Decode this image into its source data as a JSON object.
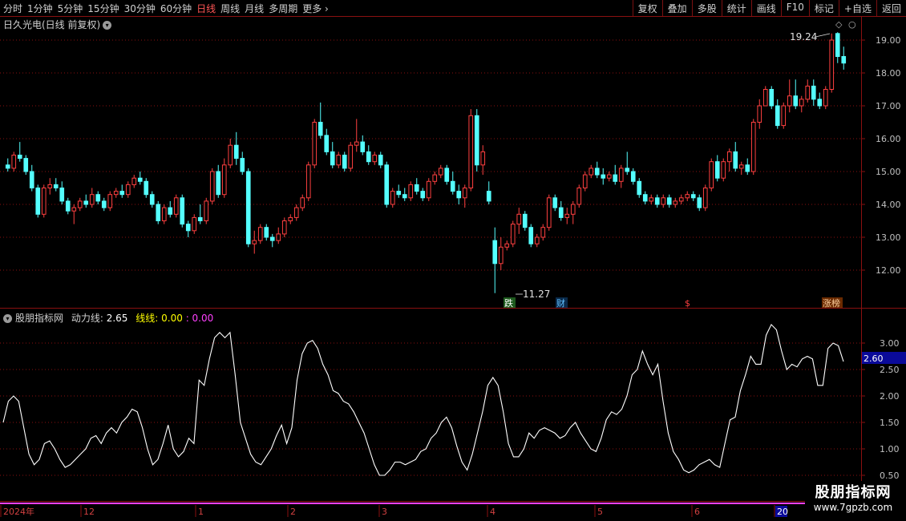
{
  "toolbar": {
    "periods": [
      "分时",
      "1分钟",
      "5分钟",
      "15分钟",
      "30分钟",
      "60分钟",
      "日线",
      "周线",
      "月线",
      "多周期",
      "更多"
    ],
    "active_period": "日线",
    "actions": [
      "复权",
      "叠加",
      "多股",
      "统计",
      "画线",
      "F10",
      "标记",
      "+自选",
      "返回"
    ]
  },
  "main_title": "日久光电(日线 前复权)",
  "price_axis": [
    "19.00",
    "18.00",
    "17.00",
    "16.00",
    "15.00",
    "14.00",
    "13.00",
    "12.00"
  ],
  "annotations": {
    "high_label": "19.24",
    "low_label": "11.27",
    "markers": [
      "跌",
      "财",
      "$",
      "涨榜"
    ]
  },
  "indicator": {
    "name": "股朋指标网",
    "line1_label": "动力线:",
    "line1_value": "2.65",
    "line2_label": "线线:",
    "line2_value": "0.00",
    "line3_value": ": 0.00",
    "axis": [
      "3.00",
      "2.50",
      "2.00",
      "1.50",
      "1.00",
      "0.50"
    ],
    "current_value": "2.60"
  },
  "date_axis": [
    "2024年",
    "12",
    "1",
    "2",
    "3",
    "4",
    "5",
    "6",
    "20"
  ],
  "watermark": {
    "line1": "股朋指标网",
    "line2": "www.7gpzb.com"
  },
  "colors": {
    "up": "#ff4040",
    "down": "#54ffff",
    "grid": "#8a1010",
    "active": "#ff5555"
  },
  "chart_data": [
    {
      "type": "candlestick",
      "title": "日久光电(日线 前复权)",
      "ylim": [
        11.0,
        19.6
      ],
      "annotations": [
        {
          "label": "19.24",
          "kind": "high"
        },
        {
          "label": "11.27",
          "kind": "low"
        }
      ],
      "ohlc": [
        [
          15.2,
          15.4,
          15.0,
          15.1
        ],
        [
          15.1,
          15.6,
          15.0,
          15.5
        ],
        [
          15.5,
          15.9,
          15.3,
          15.4
        ],
        [
          15.4,
          15.5,
          14.9,
          15.0
        ],
        [
          15.0,
          15.2,
          14.4,
          14.5
        ],
        [
          14.5,
          14.6,
          13.6,
          13.7
        ],
        [
          13.7,
          14.6,
          13.6,
          14.5
        ],
        [
          14.5,
          14.8,
          14.3,
          14.6
        ],
        [
          14.6,
          14.8,
          14.4,
          14.5
        ],
        [
          14.5,
          14.7,
          14.0,
          14.1
        ],
        [
          14.1,
          14.2,
          13.7,
          13.8
        ],
        [
          13.8,
          14.0,
          13.4,
          13.9
        ],
        [
          13.9,
          14.2,
          13.8,
          14.1
        ],
        [
          14.1,
          14.3,
          13.9,
          14.0
        ],
        [
          14.0,
          14.5,
          13.9,
          14.3
        ],
        [
          14.3,
          14.4,
          14.0,
          14.1
        ],
        [
          14.1,
          14.2,
          13.8,
          13.9
        ],
        [
          13.9,
          14.4,
          13.8,
          14.3
        ],
        [
          14.3,
          14.5,
          14.2,
          14.4
        ],
        [
          14.4,
          14.6,
          14.2,
          14.3
        ],
        [
          14.3,
          14.7,
          14.2,
          14.6
        ],
        [
          14.6,
          14.9,
          14.5,
          14.8
        ],
        [
          14.8,
          15.0,
          14.6,
          14.7
        ],
        [
          14.7,
          14.8,
          14.2,
          14.3
        ],
        [
          14.3,
          14.4,
          13.9,
          14.0
        ],
        [
          14.0,
          14.1,
          13.4,
          13.5
        ],
        [
          13.5,
          14.0,
          13.4,
          13.9
        ],
        [
          13.9,
          14.1,
          13.6,
          13.7
        ],
        [
          13.7,
          14.3,
          13.6,
          14.2
        ],
        [
          14.2,
          14.3,
          13.3,
          13.4
        ],
        [
          13.4,
          13.5,
          13.0,
          13.2
        ],
        [
          13.2,
          13.7,
          13.1,
          13.6
        ],
        [
          13.6,
          14.0,
          13.4,
          13.5
        ],
        [
          13.5,
          14.2,
          13.4,
          14.1
        ],
        [
          14.1,
          15.1,
          14.0,
          15.0
        ],
        [
          15.0,
          15.2,
          14.2,
          14.3
        ],
        [
          14.3,
          15.4,
          14.2,
          15.2
        ],
        [
          15.2,
          16.0,
          15.1,
          15.8
        ],
        [
          15.8,
          16.2,
          15.2,
          15.4
        ],
        [
          15.4,
          15.6,
          14.9,
          15.0
        ],
        [
          15.0,
          15.1,
          12.7,
          12.8
        ],
        [
          12.8,
          13.2,
          12.5,
          12.9
        ],
        [
          12.9,
          13.4,
          12.8,
          13.3
        ],
        [
          13.3,
          13.4,
          12.9,
          13.0
        ],
        [
          13.0,
          13.1,
          12.7,
          12.9
        ],
        [
          12.9,
          13.3,
          12.8,
          13.1
        ],
        [
          13.1,
          13.6,
          13.0,
          13.5
        ],
        [
          13.5,
          13.7,
          13.4,
          13.6
        ],
        [
          13.6,
          14.0,
          13.5,
          13.9
        ],
        [
          13.9,
          14.3,
          13.8,
          14.2
        ],
        [
          14.2,
          15.3,
          14.1,
          15.2
        ],
        [
          15.2,
          16.6,
          15.1,
          16.5
        ],
        [
          16.5,
          17.1,
          16.0,
          16.1
        ],
        [
          16.1,
          16.3,
          15.5,
          15.6
        ],
        [
          15.6,
          15.9,
          15.1,
          15.2
        ],
        [
          15.2,
          15.6,
          15.1,
          15.5
        ],
        [
          15.5,
          15.6,
          15.0,
          15.1
        ],
        [
          15.1,
          15.9,
          15.0,
          15.8
        ],
        [
          15.8,
          16.6,
          15.6,
          15.9
        ],
        [
          15.9,
          16.1,
          15.5,
          15.6
        ],
        [
          15.6,
          15.8,
          15.2,
          15.3
        ],
        [
          15.3,
          15.6,
          15.2,
          15.5
        ],
        [
          15.5,
          15.6,
          15.1,
          15.2
        ],
        [
          15.2,
          15.3,
          13.9,
          14.0
        ],
        [
          14.0,
          14.5,
          13.9,
          14.4
        ],
        [
          14.4,
          14.6,
          14.2,
          14.3
        ],
        [
          14.3,
          14.5,
          14.1,
          14.2
        ],
        [
          14.2,
          14.7,
          14.1,
          14.6
        ],
        [
          14.6,
          14.8,
          14.3,
          14.4
        ],
        [
          14.4,
          14.5,
          14.1,
          14.2
        ],
        [
          14.2,
          14.8,
          14.1,
          14.7
        ],
        [
          14.7,
          15.0,
          14.6,
          14.9
        ],
        [
          14.9,
          15.2,
          14.8,
          15.1
        ],
        [
          15.1,
          15.2,
          14.6,
          14.7
        ],
        [
          14.7,
          15.0,
          14.3,
          14.4
        ],
        [
          14.4,
          14.6,
          14.0,
          14.2
        ],
        [
          14.2,
          14.6,
          13.9,
          14.5
        ],
        [
          14.5,
          16.9,
          14.4,
          16.7
        ],
        [
          16.7,
          16.9,
          15.0,
          15.2
        ],
        [
          15.2,
          15.8,
          14.9,
          15.6
        ],
        [
          14.4,
          14.7,
          14.0,
          14.1
        ],
        [
          12.9,
          13.3,
          11.3,
          12.2
        ],
        [
          12.2,
          13.0,
          12.0,
          12.7
        ],
        [
          12.7,
          12.9,
          12.6,
          12.8
        ],
        [
          12.8,
          13.5,
          12.7,
          13.4
        ],
        [
          13.4,
          13.9,
          13.1,
          13.7
        ],
        [
          13.7,
          13.8,
          13.2,
          13.3
        ],
        [
          13.3,
          13.4,
          12.7,
          12.8
        ],
        [
          12.8,
          13.1,
          12.7,
          13.0
        ],
        [
          13.0,
          13.4,
          12.9,
          13.3
        ],
        [
          13.3,
          14.3,
          13.2,
          14.2
        ],
        [
          14.2,
          14.3,
          13.8,
          13.9
        ],
        [
          13.9,
          14.1,
          13.5,
          13.6
        ],
        [
          13.6,
          13.9,
          13.4,
          13.7
        ],
        [
          13.7,
          14.1,
          13.4,
          14.0
        ],
        [
          14.0,
          14.6,
          13.9,
          14.5
        ],
        [
          14.5,
          15.0,
          14.4,
          14.9
        ],
        [
          14.9,
          15.2,
          14.8,
          15.1
        ],
        [
          15.1,
          15.3,
          14.8,
          14.9
        ],
        [
          14.9,
          15.1,
          14.6,
          14.8
        ],
        [
          14.8,
          15.0,
          14.7,
          14.9
        ],
        [
          14.9,
          15.2,
          14.6,
          14.7
        ],
        [
          14.7,
          15.2,
          14.5,
          15.1
        ],
        [
          15.1,
          15.6,
          14.9,
          15.0
        ],
        [
          15.0,
          15.1,
          14.6,
          14.7
        ],
        [
          14.7,
          14.8,
          14.2,
          14.3
        ],
        [
          14.3,
          14.4,
          14.0,
          14.1
        ],
        [
          14.1,
          14.3,
          14.0,
          14.2
        ],
        [
          14.2,
          14.3,
          13.9,
          14.0
        ],
        [
          14.0,
          14.3,
          13.9,
          14.2
        ],
        [
          14.2,
          14.3,
          13.9,
          14.0
        ],
        [
          14.0,
          14.2,
          13.9,
          14.1
        ],
        [
          14.1,
          14.3,
          14.0,
          14.2
        ],
        [
          14.2,
          14.4,
          14.1,
          14.3
        ],
        [
          14.3,
          14.4,
          14.1,
          14.2
        ],
        [
          14.2,
          14.3,
          13.8,
          13.9
        ],
        [
          13.9,
          14.6,
          13.8,
          14.5
        ],
        [
          14.5,
          15.4,
          14.4,
          15.3
        ],
        [
          15.3,
          15.5,
          14.7,
          14.8
        ],
        [
          14.8,
          15.4,
          14.7,
          15.3
        ],
        [
          15.3,
          15.7,
          15.0,
          15.6
        ],
        [
          15.6,
          15.9,
          15.0,
          15.1
        ],
        [
          15.1,
          15.3,
          14.9,
          15.2
        ],
        [
          15.2,
          15.4,
          14.9,
          15.0
        ],
        [
          15.0,
          16.6,
          14.9,
          16.5
        ],
        [
          16.5,
          17.2,
          16.3,
          17.0
        ],
        [
          17.0,
          17.6,
          17.1,
          17.5
        ],
        [
          17.5,
          17.6,
          16.9,
          17.0
        ],
        [
          17.0,
          17.2,
          16.3,
          16.4
        ],
        [
          16.4,
          17.1,
          16.3,
          17.0
        ],
        [
          17.0,
          17.8,
          16.8,
          17.3
        ],
        [
          17.3,
          17.8,
          16.9,
          17.0
        ],
        [
          17.0,
          17.3,
          16.8,
          17.2
        ],
        [
          17.2,
          17.8,
          17.1,
          17.6
        ],
        [
          17.6,
          17.8,
          17.0,
          17.2
        ],
        [
          17.2,
          17.4,
          16.9,
          17.0
        ],
        [
          17.0,
          17.6,
          16.9,
          17.5
        ],
        [
          17.5,
          19.2,
          17.4,
          19.0
        ],
        [
          19.2,
          19.24,
          18.3,
          18.5
        ],
        [
          18.5,
          18.8,
          18.1,
          18.3
        ]
      ]
    },
    {
      "type": "line",
      "title": "股朋指标网",
      "ylim": [
        0.4,
        3.45
      ],
      "series": [
        {
          "name": "动力线",
          "values": [
            1.5,
            1.9,
            2.0,
            1.9,
            1.4,
            0.9,
            0.7,
            0.8,
            1.1,
            1.15,
            1.0,
            0.8,
            0.65,
            0.7,
            0.8,
            0.9,
            1.0,
            1.2,
            1.25,
            1.1,
            1.3,
            1.4,
            1.3,
            1.5,
            1.6,
            1.75,
            1.7,
            1.4,
            1.0,
            0.7,
            0.8,
            1.1,
            1.45,
            1.0,
            0.85,
            0.95,
            1.2,
            1.1,
            2.3,
            2.2,
            2.7,
            3.1,
            3.2,
            3.1,
            3.2,
            2.4,
            1.5,
            1.2,
            0.9,
            0.75,
            0.7,
            0.85,
            1.0,
            1.25,
            1.45,
            1.1,
            1.4,
            2.3,
            2.8,
            3.0,
            3.05,
            2.9,
            2.6,
            2.4,
            2.1,
            2.05,
            1.9,
            1.85,
            1.7,
            1.5,
            1.3,
            1.0,
            0.7,
            0.5,
            0.5,
            0.6,
            0.75,
            0.75,
            0.7,
            0.75,
            0.8,
            0.95,
            1.0,
            1.2,
            1.3,
            1.5,
            1.6,
            1.4,
            1.05,
            0.75,
            0.6,
            0.9,
            1.3,
            1.7,
            2.2,
            2.35,
            2.2,
            1.7,
            1.1,
            0.85,
            0.85,
            1.0,
            1.3,
            1.2,
            1.35,
            1.4,
            1.35,
            1.3,
            1.2,
            1.25,
            1.4,
            1.5,
            1.3,
            1.15,
            1.0,
            0.95,
            1.2,
            1.55,
            1.7,
            1.65,
            1.75,
            2.0,
            2.4,
            2.5,
            2.85,
            2.6,
            2.4,
            2.6,
            1.9,
            1.3,
            0.95,
            0.8,
            0.6,
            0.55,
            0.6,
            0.7,
            0.75,
            0.8,
            0.7,
            0.65,
            1.1,
            1.55,
            1.6,
            2.1,
            2.4,
            2.75,
            2.6,
            2.6,
            3.15,
            3.35,
            3.25,
            2.85,
            2.5,
            2.6,
            2.55,
            2.7,
            2.75,
            2.7,
            2.2,
            2.2,
            2.9,
            3.0,
            2.95,
            2.65
          ]
        }
      ]
    }
  ]
}
